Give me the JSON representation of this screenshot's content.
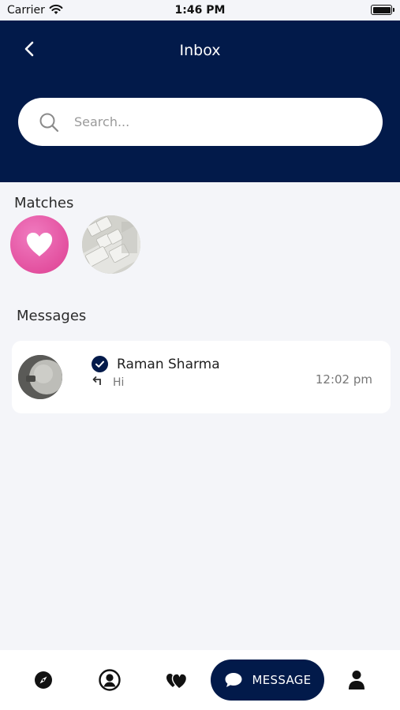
{
  "status_bar": {
    "carrier": "Carrier",
    "time": "1:46 PM"
  },
  "header": {
    "title": "Inbox"
  },
  "search": {
    "placeholder": "Search..."
  },
  "matches": {
    "title": "Matches",
    "items": [
      {
        "kind": "likes",
        "icon": "heart-icon"
      },
      {
        "kind": "avatar",
        "icon": "keyboard-photo"
      }
    ]
  },
  "messages": {
    "title": "Messages",
    "items": [
      {
        "name": "Raman Sharma",
        "preview": "Hi",
        "time": "12:02 pm",
        "verified": true
      }
    ]
  },
  "bottom_nav": {
    "items": [
      {
        "icon": "compass-icon"
      },
      {
        "icon": "user-circle-icon"
      },
      {
        "icon": "hearts-icon"
      },
      {
        "icon": "chat-bubble-icon",
        "label": "MESSAGE",
        "active": true
      },
      {
        "icon": "person-icon"
      }
    ]
  },
  "colors": {
    "primary": "#021a4a",
    "background": "#f4f5f9",
    "match_pink": "#e3509f"
  }
}
